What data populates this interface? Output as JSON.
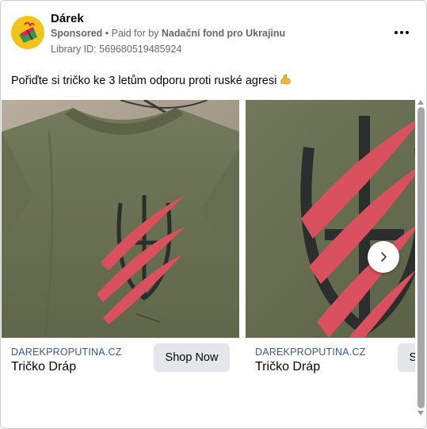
{
  "ad": {
    "page_name": "Dárek",
    "sponsored": "Sponsored",
    "separator": "•",
    "paid_for_prefix": "Paid for by",
    "funder": "Nadační fond pro Ukrajinu",
    "library_id": "Library ID: 569680519485924",
    "body_text": "Pořiďte si tričko ke 3 letům odporu proti ruské agresi",
    "body_emoji": "flexed-biceps-emoji",
    "more_icon": "more-horizontal-icon"
  },
  "carousel": {
    "cards": [
      {
        "domain": "DAREKPROPUTINA.CZ",
        "title": "Tričko Dráp",
        "cta": "Shop Now",
        "image": "olive-tshirt-trident-claw-print"
      },
      {
        "domain": "DAREKPROPUTINA.CZ",
        "title": "Tričko Dráp",
        "cta": "Shop Now",
        "image": "olive-tshirt-trident-claw-closeup"
      }
    ],
    "next_icon": "chevron-right-icon"
  },
  "colors": {
    "link": "#385898",
    "secondary_text": "#65676b",
    "button_bg": "#e4e6eb",
    "claw_red": "#d9505f",
    "shirt_olive": "#6d7357"
  }
}
